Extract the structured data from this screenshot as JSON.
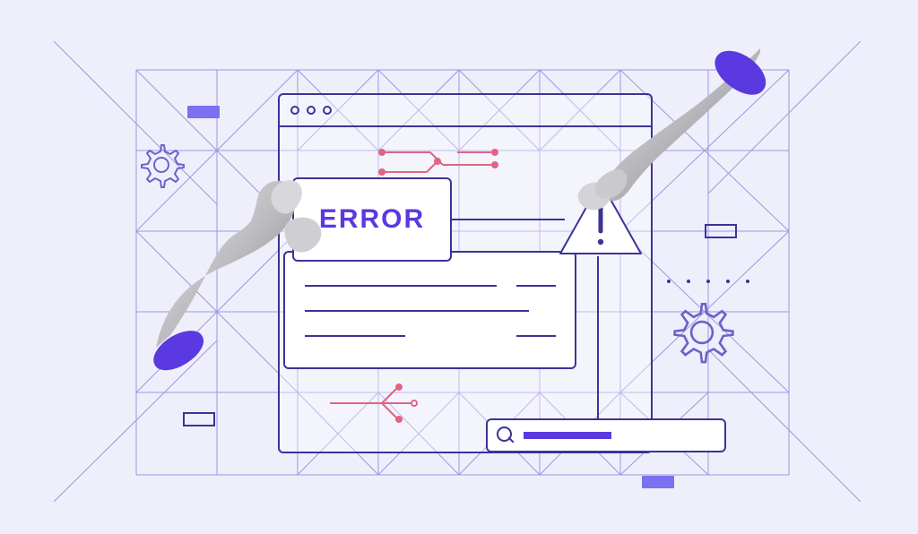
{
  "error_card": {
    "label": "ERROR"
  },
  "warning_triangle": {
    "glyph": "!"
  },
  "search_bar": {
    "progress_pct": 46
  },
  "colors": {
    "background": "#efeffc",
    "outline": "#3c3399",
    "accent": "#5b39e0",
    "circuit": "#e06484"
  }
}
